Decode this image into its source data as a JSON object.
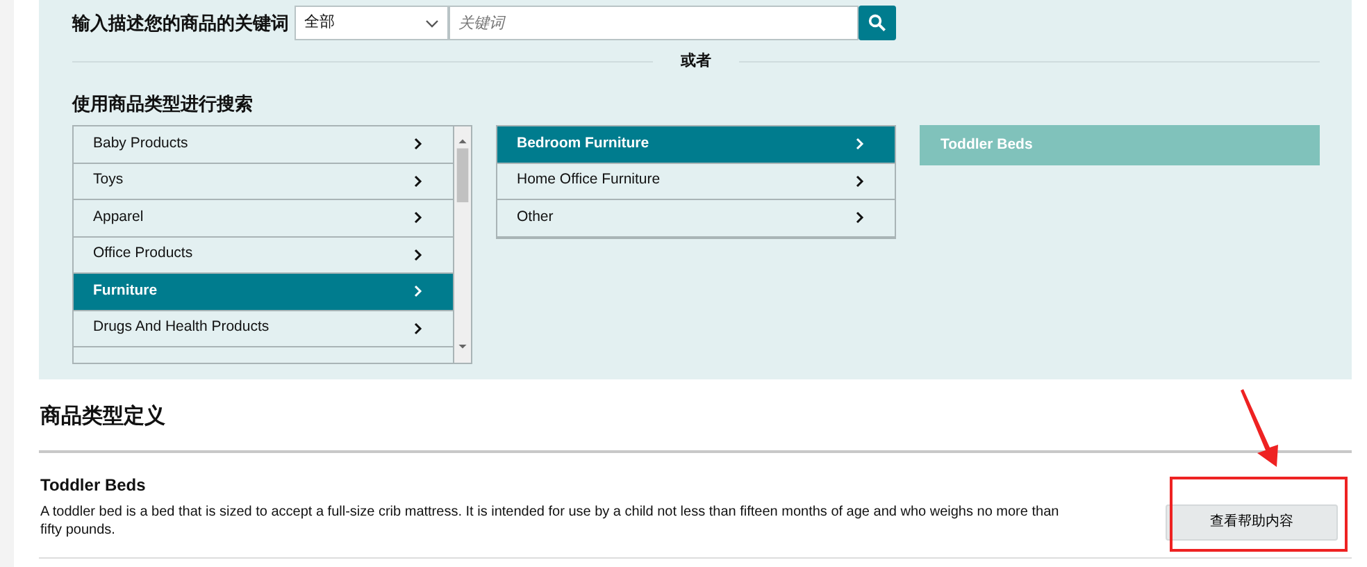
{
  "search": {
    "label": "输入描述您的商品的关键词",
    "category_select": "全部",
    "placeholder": "关键词"
  },
  "divider_text": "或者",
  "browse": {
    "heading": "使用商品类型进行搜索",
    "columns": [
      {
        "scrollable": true,
        "items": [
          {
            "label": "Baby Products",
            "selected": false,
            "has_children": true
          },
          {
            "label": "Toys",
            "selected": false,
            "has_children": true
          },
          {
            "label": "Apparel",
            "selected": false,
            "has_children": true
          },
          {
            "label": "Office Products",
            "selected": false,
            "has_children": true
          },
          {
            "label": "Furniture",
            "selected": true,
            "has_children": true
          },
          {
            "label": "Drugs And Health Products",
            "selected": false,
            "has_children": true
          }
        ]
      },
      {
        "scrollable": false,
        "items": [
          {
            "label": "Bedroom Furniture",
            "selected": true,
            "has_children": true
          },
          {
            "label": "Home Office Furniture",
            "selected": false,
            "has_children": true
          },
          {
            "label": "Other",
            "selected": false,
            "has_children": true
          }
        ]
      },
      {
        "scrollable": false,
        "items": [
          {
            "label": "Toddler Beds",
            "selected": true,
            "has_children": false
          }
        ]
      }
    ]
  },
  "definition": {
    "heading": "商品类型定义",
    "title": "Toddler Beds",
    "description": "A toddler bed is a bed that is sized to accept a full-size crib mattress. It is intended for use by a child not less than fifteen months of age and who weighs no more than fifty pounds.",
    "help_button": "查看帮助内容"
  }
}
